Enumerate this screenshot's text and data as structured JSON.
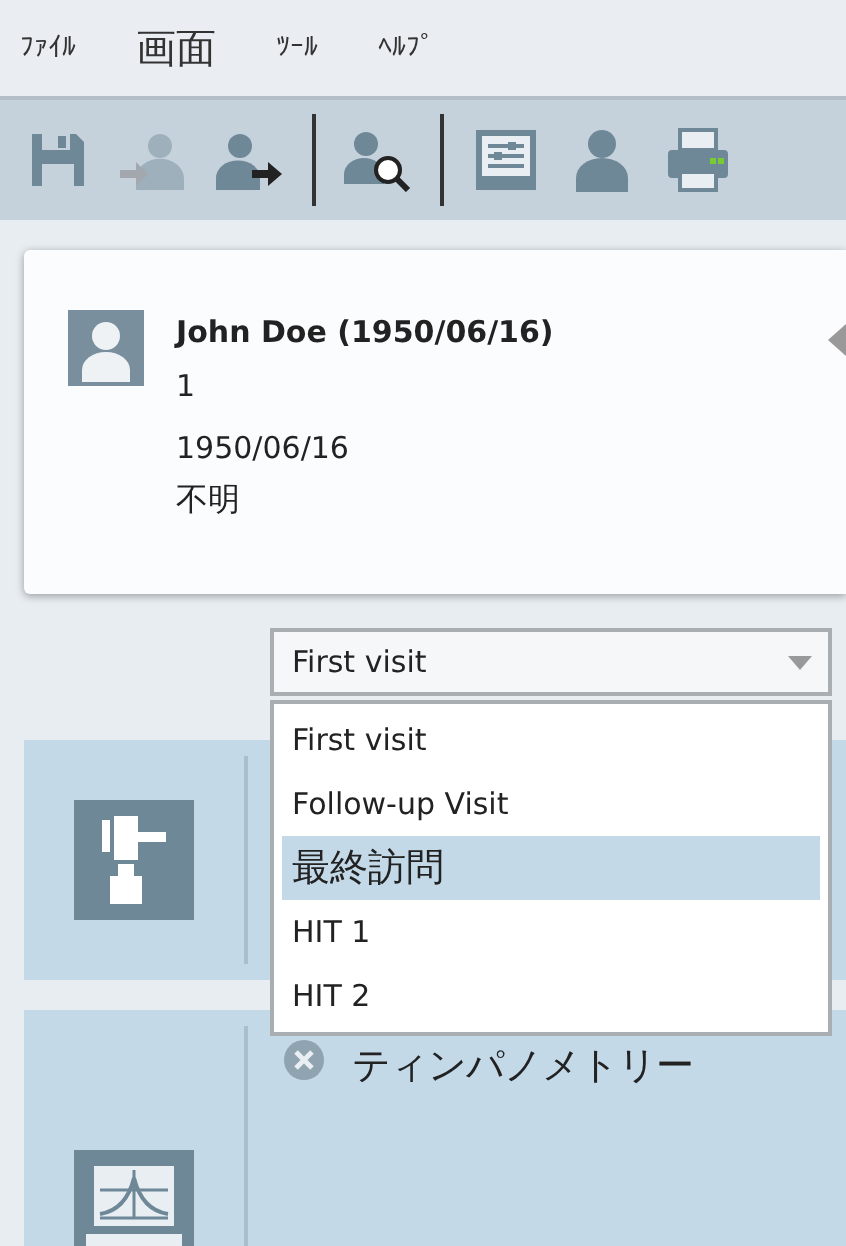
{
  "menu": [
    {
      "label": "ﾌｧｲﾙ",
      "kind": "small"
    },
    {
      "label": "画面",
      "kind": "large"
    },
    {
      "label": "ﾂｰﾙ",
      "kind": "small"
    },
    {
      "label": "ﾍﾙﾌﾟ",
      "kind": "small"
    }
  ],
  "toolbar": [
    {
      "kind": "save",
      "disabled": false
    },
    {
      "kind": "import",
      "disabled": true
    },
    {
      "kind": "export",
      "disabled": false
    },
    {
      "kind": "separator"
    },
    {
      "kind": "search",
      "disabled": false
    },
    {
      "kind": "separator"
    },
    {
      "kind": "settings",
      "disabled": false
    },
    {
      "kind": "user",
      "disabled": false
    },
    {
      "kind": "print",
      "disabled": false
    }
  ],
  "patient": {
    "name": "John Doe (1950/06/16)",
    "id": "1",
    "birthdate": "1950/06/16",
    "sex": "不明"
  },
  "visit_select": {
    "value": "First visit",
    "expanded": true,
    "options": [
      {
        "label": "First visit",
        "highlighted": false
      },
      {
        "label": "Follow-up Visit",
        "highlighted": false
      },
      {
        "label": "最終訪問",
        "highlighted": true
      },
      {
        "label": "HIT 1",
        "highlighted": false
      },
      {
        "label": "HIT 2",
        "highlighted": false
      }
    ]
  },
  "modules": [
    {
      "kind": "otoscope"
    },
    {
      "kind": "tympanometer",
      "label": "ティンパノメトリー",
      "failed": true
    }
  ]
}
